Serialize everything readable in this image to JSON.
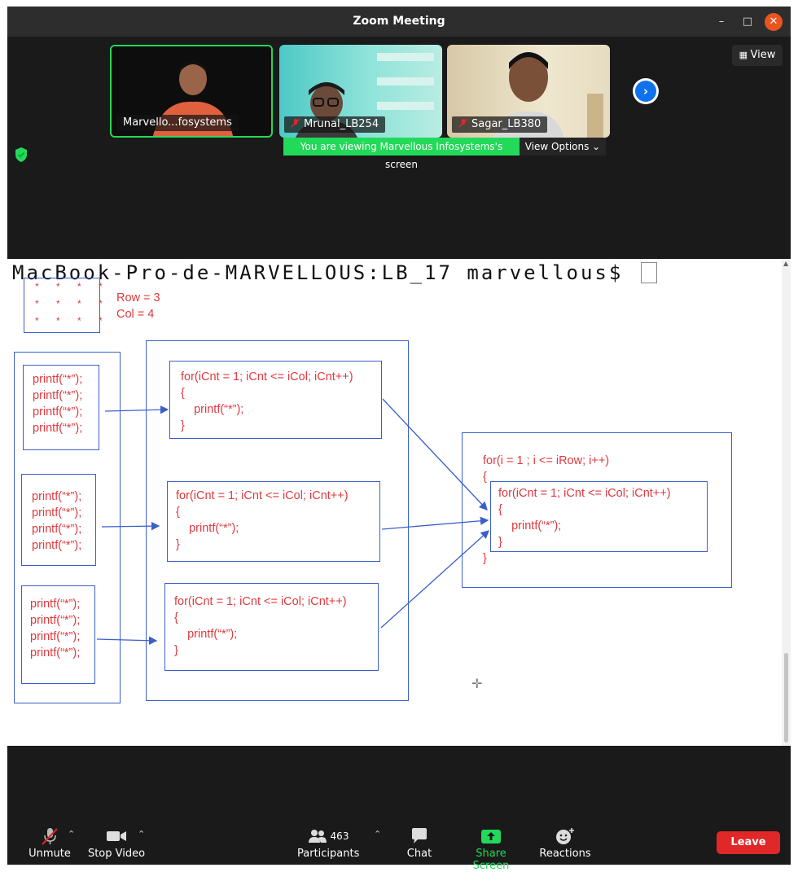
{
  "window": {
    "title": "Zoom Meeting"
  },
  "participants_strip": [
    {
      "name": "Marvello...fosystems",
      "active_speaker": true,
      "muted": false
    },
    {
      "name": "Mrunal_LB254",
      "active_speaker": false,
      "muted": true
    },
    {
      "name": "Sagar_LB380",
      "active_speaker": false,
      "muted": true
    }
  ],
  "view_button": {
    "label": "View"
  },
  "share_banner": {
    "text": "You are viewing Marvellous Infosystems's screen",
    "options_label": "View Options"
  },
  "shared_screen": {
    "terminal_prompt": "MacBook-Pro-de-MARVELLOUS:LB_17 marvellous$ ",
    "stars_rows": [
      "* * * *",
      "* * * *",
      "* * * *"
    ],
    "row_label": "Row = 3",
    "col_label": "Col = 4",
    "printf_line": "printf(“*”);",
    "inner_loop": {
      "header": "for(iCnt = 1; iCnt <= iCol; iCnt++)",
      "open": "{",
      "body": "    printf(“*”);",
      "close": "}"
    },
    "outer_loop": {
      "header": "for(i = 1 ; i <= iRow; i++)",
      "open": "{",
      "close": "}"
    }
  },
  "toolbar": {
    "unmute": "Unmute",
    "stop_video": "Stop Video",
    "participants": "Participants",
    "participants_count": "463",
    "chat": "Chat",
    "share_screen": "Share Screen",
    "reactions": "Reactions",
    "leave": "Leave"
  },
  "colors": {
    "share_green": "#23d959",
    "leave_red": "#e02828",
    "zoom_blue": "#0e72ed",
    "code_red": "#e0393e",
    "diagram_blue": "#3b5fc9"
  }
}
